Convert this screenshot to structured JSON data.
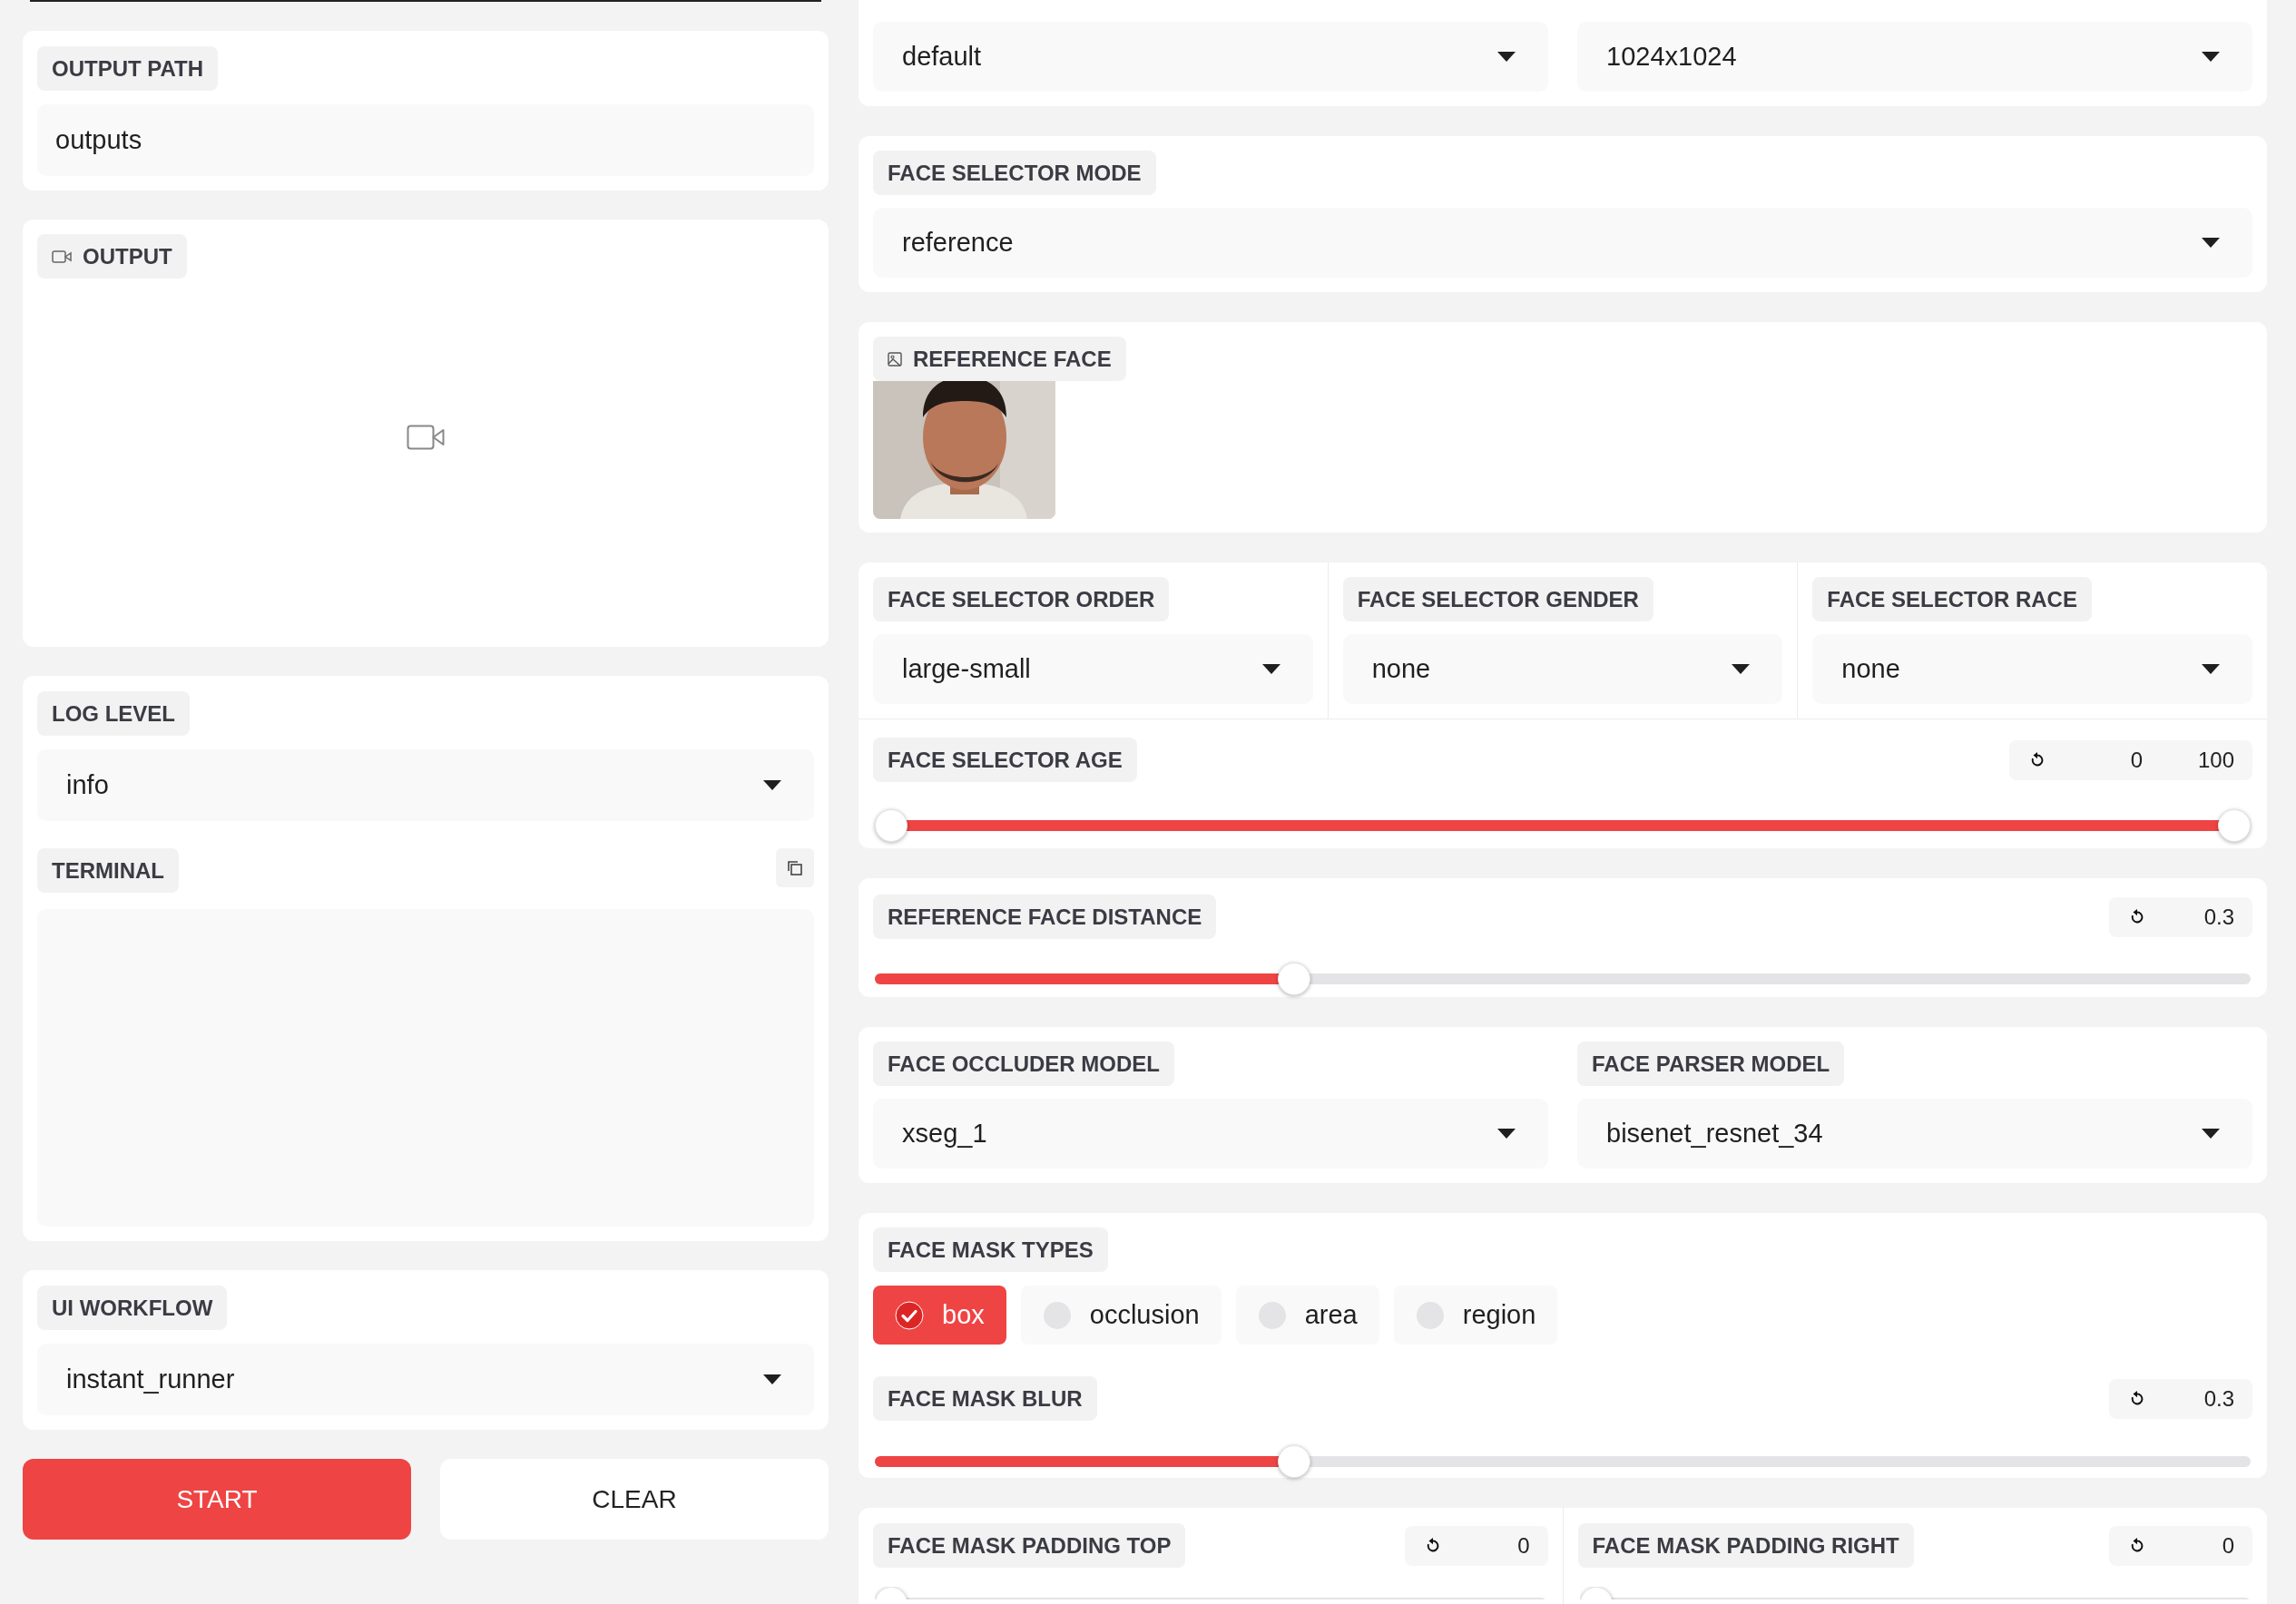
{
  "left": {
    "output_path": {
      "label": "OUTPUT PATH",
      "value": "outputs"
    },
    "output": {
      "label": "OUTPUT"
    },
    "log_level": {
      "label": "LOG LEVEL",
      "value": "info"
    },
    "terminal": {
      "label": "TERMINAL"
    },
    "ui_workflow": {
      "label": "UI WORKFLOW",
      "value": "instant_runner"
    },
    "buttons": [
      {
        "label": "START",
        "kind": "primary"
      },
      {
        "label": "CLEAR",
        "kind": "secondary"
      }
    ]
  },
  "right": {
    "top_dropdowns": [
      {
        "value": "default"
      },
      {
        "value": "1024x1024"
      }
    ],
    "face_selector_mode": {
      "label": "FACE SELECTOR MODE",
      "value": "reference"
    },
    "reference_face": {
      "label": "REFERENCE FACE"
    },
    "selector_dropdowns": [
      {
        "label": "FACE SELECTOR ORDER",
        "value": "large-small"
      },
      {
        "label": "FACE SELECTOR GENDER",
        "value": "none"
      },
      {
        "label": "FACE SELECTOR RACE",
        "value": "none"
      }
    ],
    "face_selector_age": {
      "label": "FACE SELECTOR AGE",
      "values": [
        "0",
        "100"
      ],
      "thumbs": [
        {
          "level": 0
        },
        {
          "level": 1
        }
      ]
    },
    "reference_face_distance": {
      "label": "REFERENCE FACE DISTANCE",
      "value": "0.3",
      "level": 0.3
    },
    "models": [
      {
        "label": "FACE OCCLUDER MODEL",
        "value": "xseg_1"
      },
      {
        "label": "FACE PARSER MODEL",
        "value": "bisenet_resnet_34"
      }
    ],
    "face_mask_types": {
      "label": "FACE MASK TYPES",
      "options": [
        {
          "label": "box",
          "checked": true
        },
        {
          "label": "occlusion",
          "checked": false
        },
        {
          "label": "area",
          "checked": false
        },
        {
          "label": "region",
          "checked": false
        }
      ]
    },
    "face_mask_blur": {
      "label": "FACE MASK BLUR",
      "value": "0.3",
      "level": 0.3
    },
    "padding": [
      {
        "label": "FACE MASK PADDING TOP",
        "value": "0",
        "level": 0
      },
      {
        "label": "FACE MASK PADDING RIGHT",
        "value": "0",
        "level": 0
      }
    ]
  }
}
